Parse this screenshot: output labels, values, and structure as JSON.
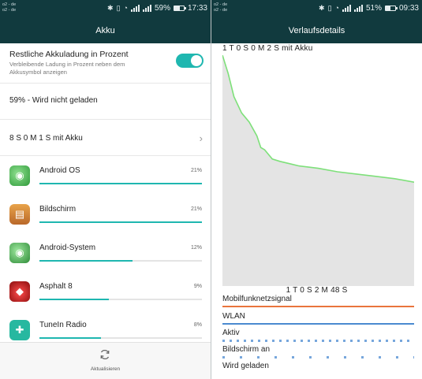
{
  "left": {
    "status": {
      "carrier1": "o2 - de",
      "carrier2": "o2 - de",
      "battery_pct": "59%",
      "battery_level": 0.59,
      "time": "17:33"
    },
    "title": "Akku",
    "toggle": {
      "title": "Restliche Akkuladung in Prozent",
      "subtitle": "Verbleibende Ladung in Prozent neben dem Akkusymbol anzeigen",
      "on": true
    },
    "charge_status": "59% - Wird nicht geladen",
    "usage_duration": "8 S 0 M 1 S mit Akku",
    "apps": [
      {
        "name": "Android OS",
        "pct": "21%",
        "level": 0.21,
        "icon": "android-os-icon"
      },
      {
        "name": "Bildschirm",
        "pct": "21%",
        "level": 0.21,
        "icon": "display-icon"
      },
      {
        "name": "Android-System",
        "pct": "12%",
        "level": 0.12,
        "icon": "android-system-icon"
      },
      {
        "name": "Asphalt 8",
        "pct": "9%",
        "level": 0.09,
        "icon": "asphalt-icon"
      },
      {
        "name": "TuneIn Radio",
        "pct": "8%",
        "level": 0.08,
        "icon": "tunein-icon"
      }
    ],
    "refresh_label": "Aktualisieren"
  },
  "right": {
    "status": {
      "carrier1": "o2 - de",
      "carrier2": "o2 - de",
      "battery_pct": "51%",
      "battery_level": 0.51,
      "time": "09:33"
    },
    "title": "Verlaufsdetails",
    "duration_top": "1 T 0 S 0 M 2 S mit Akku",
    "duration_bottom": "1 T 0 S 2 M 48 S",
    "lanes": [
      {
        "label": "Mobilfunknetzsignal",
        "color": "#e9743d"
      },
      {
        "label": "WLAN",
        "color": "#4a8ad0"
      },
      {
        "label": "Aktiv",
        "color": "#4a8ad0"
      },
      {
        "label": "Bildschirm an",
        "color": "#4a8ad0"
      },
      {
        "label": "Wird geladen",
        "color": "#4a8ad0"
      }
    ]
  },
  "colors": {
    "accent": "#1fb7b0",
    "header": "#113a3e",
    "curve": "#7ee07a"
  },
  "chart_data": {
    "type": "line",
    "title": "",
    "xlabel": "",
    "ylabel": "",
    "ylim": [
      0,
      100
    ],
    "series": [
      {
        "x": [
          0,
          0.03,
          0.06,
          0.1,
          0.14,
          0.18,
          0.2,
          0.22,
          0.26,
          0.3,
          0.35,
          0.4,
          0.45,
          0.5,
          0.6,
          0.7,
          0.8,
          0.9,
          1.0
        ],
        "values": [
          100,
          92,
          82,
          75,
          71,
          65,
          60,
          59,
          55,
          54,
          53,
          52,
          51.5,
          51,
          49.5,
          48.5,
          47.5,
          46.5,
          45
        ]
      }
    ]
  }
}
